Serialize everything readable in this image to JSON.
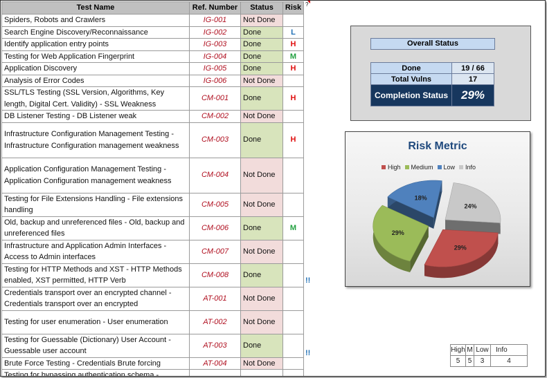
{
  "table": {
    "headers": {
      "name": "Test Name",
      "ref": "Ref. Number",
      "status": "Status",
      "risk": "Risk"
    },
    "header_mark": "?",
    "rows": [
      {
        "name": "Spiders, Robots and Crawlers",
        "ref": "IG-001",
        "status": "Not Done",
        "risk": "",
        "flag": ""
      },
      {
        "name": "Search Engine Discovery/Reconnaissance",
        "ref": "IG-002",
        "status": "Done",
        "risk": "L",
        "flag": ""
      },
      {
        "name": "Identify application entry points",
        "ref": "IG-003",
        "status": "Done",
        "risk": "H",
        "flag": ""
      },
      {
        "name": "Testing for Web Application Fingerprint",
        "ref": "IG-004",
        "status": "Done",
        "risk": "M",
        "flag": ""
      },
      {
        "name": "Application Discovery",
        "ref": "IG-005",
        "status": "Done",
        "risk": "H",
        "flag": ""
      },
      {
        "name": "Analysis of Error Codes",
        "ref": "IG-006",
        "status": "Not Done",
        "risk": "",
        "flag": ""
      },
      {
        "name": "SSL/TLS Testing (SSL Version, Algorithms, Key length, Digital Cert. Validity) - SSL Weakness",
        "ref": "CM-001",
        "status": "Done",
        "risk": "H",
        "flag": ""
      },
      {
        "name": "DB Listener Testing - DB Listener weak",
        "ref": "CM-002",
        "status": "Not Done",
        "risk": "",
        "flag": ""
      },
      {
        "name": "Infrastructure Configuration Management Testing - Infrastructure Configuration management weakness",
        "ref": "CM-003",
        "status": "Done",
        "risk": "H",
        "flag": ""
      },
      {
        "name": "Application Configuration Management Testing - Application Configuration management weakness",
        "ref": "CM-004",
        "status": "Not Done",
        "risk": "",
        "flag": ""
      },
      {
        "name": "Testing for File Extensions Handling - File extensions handling",
        "ref": "CM-005",
        "status": "Not Done",
        "risk": "",
        "flag": ""
      },
      {
        "name": "Old, backup and unreferenced files - Old, backup and unreferenced files",
        "ref": "CM-006",
        "status": "Done",
        "risk": "M",
        "flag": ""
      },
      {
        "name": "Infrastructure and Application Admin Interfaces - Access to Admin interfaces",
        "ref": "CM-007",
        "status": "Not Done",
        "risk": "",
        "flag": ""
      },
      {
        "name": "Testing for HTTP Methods and XST - HTTP Methods enabled, XST permitted, HTTP Verb",
        "ref": "CM-008",
        "status": "Done",
        "risk": "",
        "flag": "!!"
      },
      {
        "name": "Credentials transport over an encrypted channel - Credentials transport over an encrypted",
        "ref": "AT-001",
        "status": "Not Done",
        "risk": "",
        "flag": ""
      },
      {
        "name": "Testing for user enumeration - User enumeration",
        "ref": "AT-002",
        "status": "Not Done",
        "risk": "",
        "flag": ""
      },
      {
        "name": "Testing for Guessable (Dictionary) User Account - Guessable user account",
        "ref": "AT-003",
        "status": "Done",
        "risk": "",
        "flag": "!!"
      },
      {
        "name": "Brute Force Testing - Credentials Brute forcing",
        "ref": "AT-004",
        "status": "Not Done",
        "risk": "",
        "flag": ""
      },
      {
        "name": "Testing for bypassing authentication schema -",
        "ref": "",
        "status": "",
        "risk": "",
        "flag": ""
      }
    ]
  },
  "overall": {
    "title": "Overall Status",
    "done_label": "Done",
    "done_value": "19  /  66",
    "vulns_label": "Total Vulns",
    "vulns_value": "17",
    "completion_label": "Completion Status",
    "completion_value": "29%"
  },
  "chart_data": {
    "type": "pie",
    "title": "Risk Metric",
    "legend_position": "top",
    "categories": [
      "High",
      "Medium",
      "Low",
      "Info"
    ],
    "values": [
      29,
      29,
      18,
      24
    ],
    "labels": [
      "29%",
      "29%",
      "18%",
      "24%"
    ],
    "colors": [
      "#c0504d",
      "#9bbb59",
      "#4f81bd",
      "#c8c8c8"
    ],
    "exploded": true,
    "three_d": true
  },
  "summary": {
    "headers": [
      "High",
      "M",
      "Low",
      "Info"
    ],
    "values": [
      "5",
      "5",
      "3",
      "4"
    ]
  }
}
